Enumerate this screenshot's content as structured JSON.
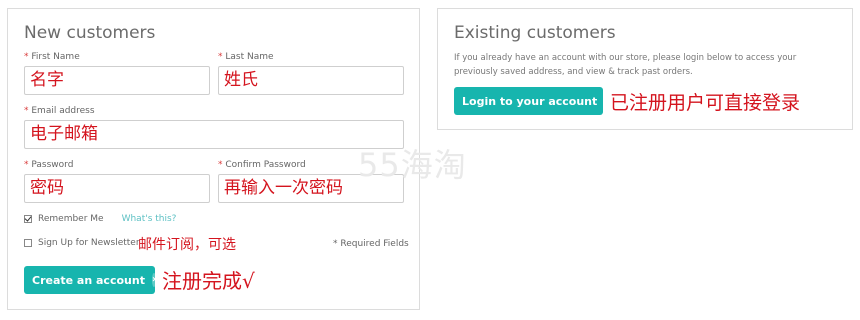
{
  "new_customers": {
    "title": "New customers",
    "required_mark": "*",
    "first_name": {
      "label": "First Name",
      "value": "名字"
    },
    "last_name": {
      "label": "Last Name",
      "value": "姓氏"
    },
    "email": {
      "label": "Email address",
      "value": "电子邮箱"
    },
    "password": {
      "label": "Password",
      "value": "密码"
    },
    "confirm_password": {
      "label": "Confirm Password",
      "value": "再输入一次密码"
    },
    "remember_me": {
      "label": "Remember Me",
      "checked": true,
      "help_link": "What's this?"
    },
    "newsletter": {
      "label": "Sign Up for Newsletter",
      "checked": false,
      "annotation": "邮件订阅，可选"
    },
    "required_fields_note": "* Required Fields",
    "create_button": {
      "label": "Create an account",
      "icon": "chevron-right-icon",
      "annotation": "注册完成√"
    }
  },
  "existing_customers": {
    "title": "Existing customers",
    "description": "If you already have an account with our store, please login below to access your previously saved address, and view & track past orders.",
    "login_button": {
      "label": "Login to your account",
      "icon": "chevron-right-icon",
      "annotation": "已注册用户可直接登录"
    }
  },
  "watermark": "55海淘",
  "colors": {
    "accent": "#17b5ae",
    "annotation": "#d4141e",
    "link": "#5ec1c4",
    "required": "#d93c3c"
  }
}
